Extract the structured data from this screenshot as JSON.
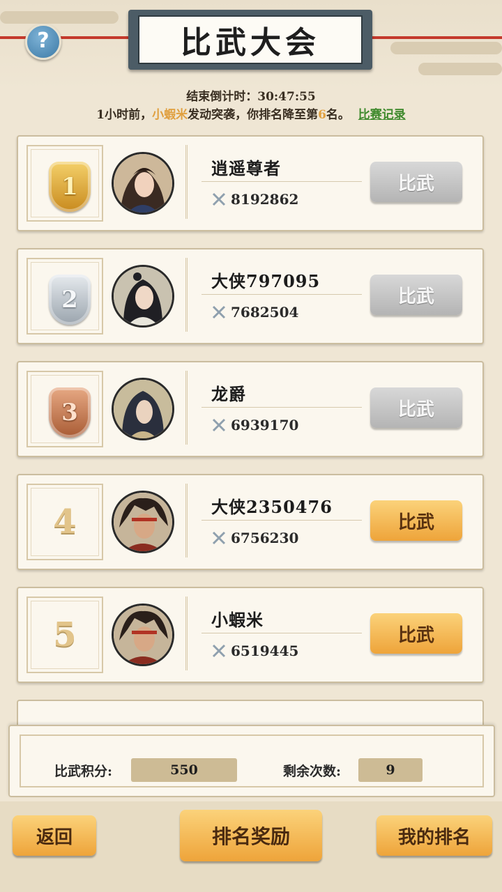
{
  "header": {
    "title": "比武大会",
    "help_icon": "?",
    "countdown_label": "结束倒计时：",
    "countdown_value": "30:47:55",
    "notice_prefix": "1小时前，",
    "notice_name": "小蝦米",
    "notice_mid": "发动突袭，你排名降至第",
    "notice_rank": "6",
    "notice_suffix": "名。",
    "record_link": "比赛记录"
  },
  "colors": {
    "accent_orange": "#eea43a",
    "link_green": "#3f8a2d",
    "highlight": "#e0a040",
    "rope_red": "#c43a2c"
  },
  "rankings": [
    {
      "rank": "1",
      "badge": "gold-medal-icon",
      "name": "逍遥尊者",
      "power": "8192862",
      "button": "比武",
      "enabled": false
    },
    {
      "rank": "2",
      "badge": "silver-medal-icon",
      "name": "大侠797095",
      "power": "7682504",
      "button": "比武",
      "enabled": false
    },
    {
      "rank": "3",
      "badge": "bronze-medal-icon",
      "name": "龙爵",
      "power": "6939170",
      "button": "比武",
      "enabled": false
    },
    {
      "rank": "4",
      "badge": "",
      "name": "大侠2350476",
      "power": "6756230",
      "button": "比武",
      "enabled": true
    },
    {
      "rank": "5",
      "badge": "",
      "name": "小蝦米",
      "power": "6519445",
      "button": "比武",
      "enabled": true
    }
  ],
  "stats": {
    "score_label": "比武积分:",
    "score_value": "550",
    "remaining_label": "剩余次数:",
    "remaining_value": "9"
  },
  "footer": {
    "back": "返回",
    "rewards": "排名奖励",
    "my_rank": "我的排名"
  }
}
